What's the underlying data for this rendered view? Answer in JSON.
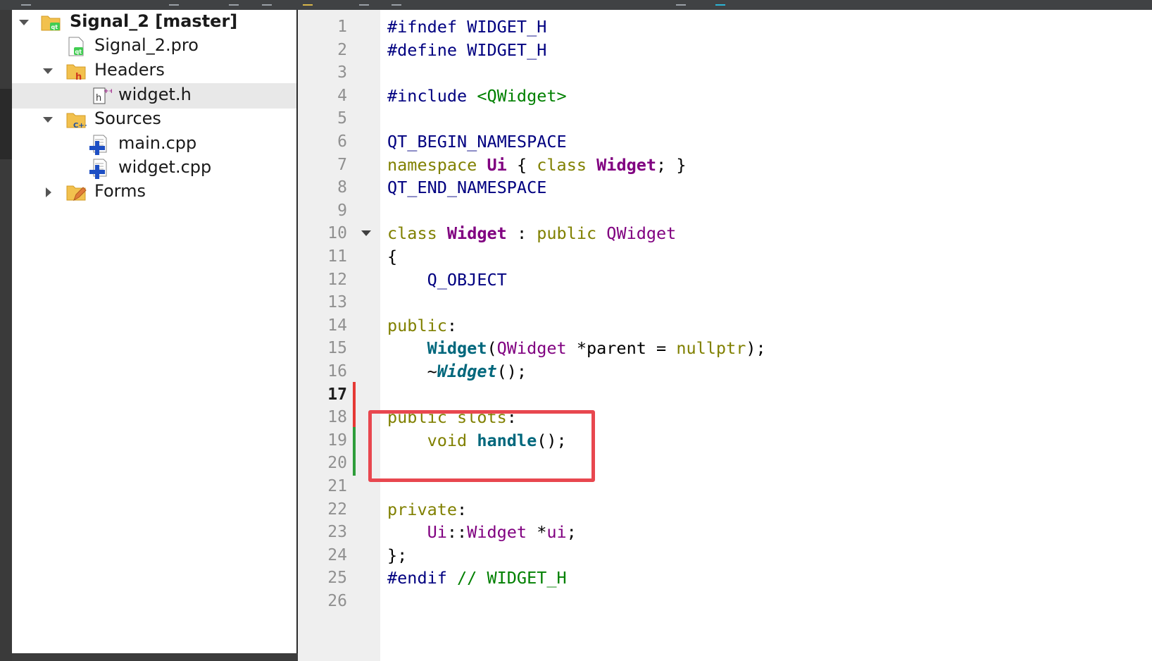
{
  "colors": {
    "highlight_border": "#e8474f",
    "changed_line_red": "#e53935",
    "added_line_green": "#2e9d3a",
    "keyword": "#808000",
    "preprocessor": "#000080",
    "string": "#008000",
    "type": "#800080",
    "function": "#00677c"
  },
  "project_tree": {
    "project": {
      "label": "Signal_2 [master]",
      "icon": "qt-project-folder-icon"
    },
    "items": [
      {
        "label": "Signal_2.pro",
        "icon": "qt-pro-file-icon"
      },
      {
        "label": "Headers",
        "icon": "headers-folder-icon"
      },
      {
        "label": "widget.h",
        "icon": "header-file-icon"
      },
      {
        "label": "Sources",
        "icon": "sources-folder-icon"
      },
      {
        "label": "main.cpp",
        "icon": "cpp-file-icon"
      },
      {
        "label": "widget.cpp",
        "icon": "cpp-file-icon"
      },
      {
        "label": "Forms",
        "icon": "forms-folder-icon"
      }
    ],
    "selected": "widget.h"
  },
  "editor": {
    "line_numbers": [
      "1",
      "2",
      "3",
      "4",
      "5",
      "6",
      "7",
      "8",
      "9",
      "10",
      "11",
      "12",
      "13",
      "14",
      "15",
      "16",
      "17",
      "18",
      "19",
      "20",
      "21",
      "22",
      "23",
      "24",
      "25",
      "26"
    ],
    "current_line": "17",
    "code": {
      "l1_a": "#ifndef",
      "l1_b": " WIDGET_H",
      "l2_a": "#define",
      "l2_b": " WIDGET_H",
      "l4_a": "#include",
      "l4_b": " <QWidget>",
      "l6": "QT_BEGIN_NAMESPACE",
      "l7_a": "namespace",
      "l7_b": " ",
      "l7_c": "Ui",
      "l7_d": " { ",
      "l7_e": "class",
      "l7_f": " ",
      "l7_g": "Widget",
      "l7_h": "; }",
      "l8": "QT_END_NAMESPACE",
      "l10_a": "class",
      "l10_b": " ",
      "l10_c": "Widget",
      "l10_d": " : ",
      "l10_e": "public",
      "l10_f": " ",
      "l10_g": "QWidget",
      "l11": "{",
      "l12": "    Q_OBJECT",
      "l14_a": "public",
      "l14_b": ":",
      "l15_a": "    ",
      "l15_b": "Widget",
      "l15_c": "(",
      "l15_d": "QWidget",
      "l15_e": " *parent = ",
      "l15_f": "nullptr",
      "l15_g": ");",
      "l16_a": "    ~",
      "l16_b": "Widget",
      "l16_c": "();",
      "l18_a": "public",
      "l18_b": " ",
      "l18_c": "slots",
      "l18_d": ":",
      "l19_a": "    ",
      "l19_b": "void",
      "l19_c": " ",
      "l19_d": "handle",
      "l19_e": "();",
      "l22_a": "private",
      "l22_b": ":",
      "l23_a": "    ",
      "l23_b": "Ui",
      "l23_c": "::",
      "l23_d": "Widget",
      "l23_e": " *",
      "l23_f": "ui",
      "l23_g": ";",
      "l24": "};",
      "l25_a": "#endif",
      "l25_b": " // WIDGET_H"
    }
  }
}
